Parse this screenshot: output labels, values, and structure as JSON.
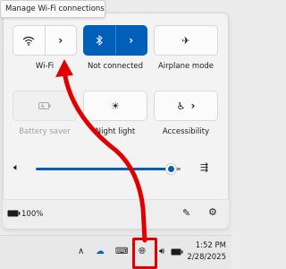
{
  "tooltip": {
    "text": "Manage Wi-Fi connections"
  },
  "tiles": {
    "wifi": {
      "label": "Wi-Fi",
      "icon": "wifi-icon"
    },
    "bluetooth": {
      "label": "Not connected",
      "icon": "bluetooth-icon",
      "state": "on"
    },
    "airplane": {
      "label": "Airplane mode",
      "icon": "airplane-icon"
    },
    "battery_saver": {
      "label": "Battery saver",
      "icon": "battery-saver-icon",
      "state": "disabled"
    },
    "night_light": {
      "label": "Night light",
      "icon": "sun-icon"
    },
    "accessibility": {
      "label": "Accessibility",
      "icon": "accessibility-icon"
    }
  },
  "volume": {
    "level_fraction": 0.93
  },
  "footer": {
    "battery_text": "100%"
  },
  "taskbar": {
    "time": "1:52 PM",
    "date": "2/28/2025"
  },
  "colors": {
    "accent": "#005fb8",
    "annotation": "#e00000"
  }
}
